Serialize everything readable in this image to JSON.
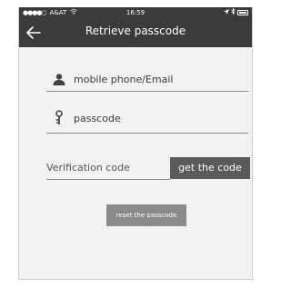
{
  "status_bar": {
    "signal": "●●●●○",
    "carrier": "A&AT",
    "time": "16:59"
  },
  "nav": {
    "title": "Retrieve passcode"
  },
  "form": {
    "account_placeholder": "mobile phone/Email",
    "passcode_placeholder": "passcode",
    "verification_placeholder": "Verification code",
    "get_code_label": "get the code",
    "reset_label": "reset the passcode"
  },
  "icons": {
    "back": "back-arrow-icon",
    "user": "user-icon",
    "key": "key-icon",
    "wifi": "wifi-icon",
    "bluetooth": "bluetooth-icon",
    "location": "location-arrow-icon",
    "battery": "battery-icon"
  },
  "colors": {
    "header": "#3b3b3b",
    "background": "#f2f2f2",
    "button_dark": "#5a5a5a",
    "button_gray": "#8a8a8a"
  }
}
